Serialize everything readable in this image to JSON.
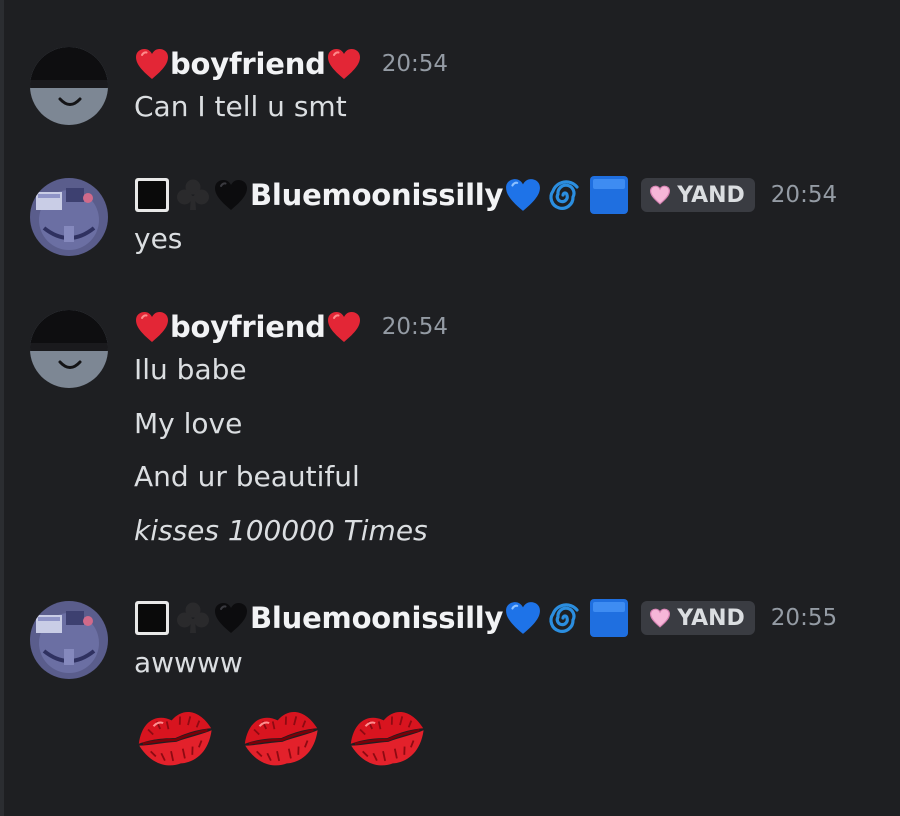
{
  "messages": [
    {
      "author": "boyfriend",
      "time": "20:54",
      "lines": [
        "Can I tell u smt"
      ]
    },
    {
      "author": "Bluemoonissilly",
      "role_tag": "YAND",
      "time": "20:54",
      "lines": [
        "yes"
      ]
    },
    {
      "author": "boyfriend",
      "time": "20:54",
      "lines": [
        "Ilu babe",
        "My love",
        "And ur beautiful",
        "kisses 100000 Times"
      ]
    },
    {
      "author": "Bluemoonissilly",
      "role_tag": "YAND",
      "time": "20:55",
      "lines": [
        "awwww"
      ]
    }
  ],
  "icons": {
    "heart": "red-heart-icon",
    "blue_heart": "blue-heart-icon",
    "black_heart": "black-heart-icon",
    "club": "club-suit-icon",
    "black_square": "black-square-icon",
    "cyclone": "cyclone-icon",
    "blue_square": "blue-square-icon",
    "pink_heart": "pink-heart-icon",
    "kiss": "kiss-mark-icon"
  },
  "colors": {
    "background": "#1e1f22",
    "text": "#dbdee1",
    "username": "#f2f3f5",
    "timestamp": "#949ba4",
    "role_tag_bg": "#3a3c42"
  }
}
